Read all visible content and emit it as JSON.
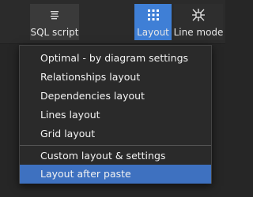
{
  "toolbar": {
    "sql_script_label": "SQL script",
    "layout_label": "Layout",
    "line_mode_label": "Line mode"
  },
  "layout_menu": {
    "items": [
      "Optimal - by diagram settings",
      "Relationships layout",
      "Dependencies layout",
      "Lines layout",
      "Grid layout",
      "Custom layout & settings",
      "Layout after paste"
    ],
    "selected": "Layout after paste"
  },
  "colors": {
    "accent": "#3f7fd6",
    "menu_highlight": "#3e71c0",
    "background": "#262626",
    "menu_background": "#2a2a2a"
  },
  "icons": [
    "document-lines-icon",
    "grid-layout-icon",
    "line-mode-icon"
  ]
}
